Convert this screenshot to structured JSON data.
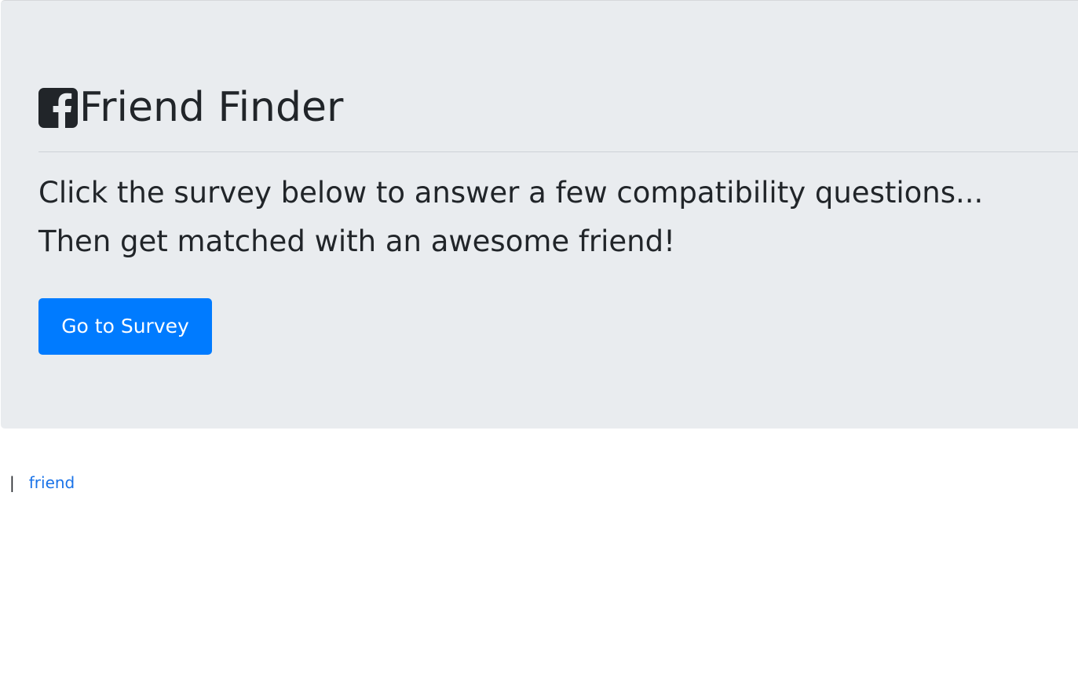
{
  "header": {
    "icon": "facebook-square-icon",
    "title": "Friend Finder"
  },
  "lead": {
    "line1": "Click the survey below to answer a few compatibility questions...",
    "line2": "Then get matched with an awesome friend!"
  },
  "actions": {
    "survey_label": "Go to Survey"
  },
  "footer": {
    "separator": "|",
    "link_label": "friend"
  },
  "colors": {
    "jumbotron_bg": "#e9ecef",
    "primary": "#007bff",
    "text": "#212529",
    "link": "#1a73e8"
  }
}
